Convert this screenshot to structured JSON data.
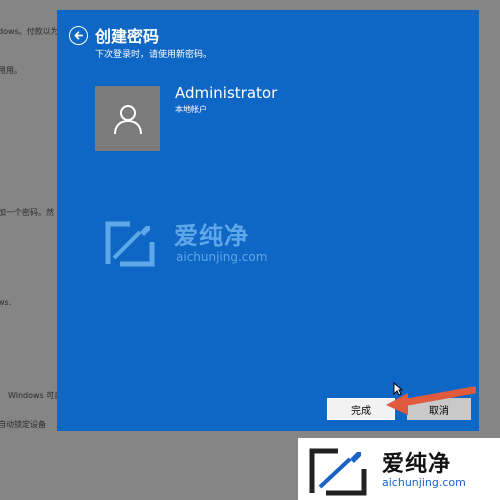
{
  "background": {
    "lines": [
      "dows。付款以为",
      "用用。",
      "加一个密码。然",
      "ws.",
      "Windows 可自",
      "自动锁定设备"
    ]
  },
  "dialog": {
    "title": "创建密码",
    "subtitle": "下次登录时，请使用新密码。",
    "account_name": "Administrator",
    "account_type": "本地帐户",
    "finish_label": "完成",
    "cancel_label": "取消",
    "accent_color": "#0f67c5"
  },
  "watermark": {
    "brand": "爱纯净",
    "url": "aichunjing.com"
  },
  "icons": [
    "back-arrow-icon",
    "user-icon",
    "mouse-cursor-icon",
    "red-arrow-icon",
    "logo-icon"
  ]
}
